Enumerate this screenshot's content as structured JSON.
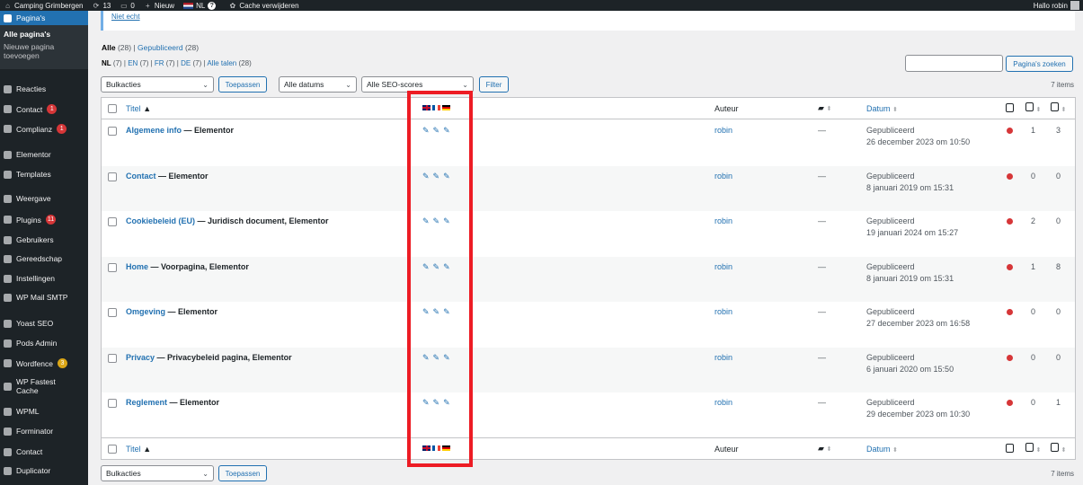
{
  "adminbar": {
    "site_name": "Camping Grimbergen",
    "updates": "13",
    "comments": "0",
    "new": "Nieuw",
    "lang": "NL",
    "cache": "Cache verwijderen",
    "greeting": "Hallo robin"
  },
  "sidebar": {
    "current": "Pagina's",
    "submenu": [
      "Alle pagina's",
      "Nieuwe pagina toevoegen"
    ],
    "items": [
      {
        "label": "Reacties",
        "icon": "comment-icon"
      },
      {
        "label": "Contact",
        "icon": "mail-icon",
        "badge": "1"
      },
      {
        "label": "Complianz",
        "icon": "check-icon",
        "badge": "1"
      },
      {
        "label": "Elementor",
        "icon": "elementor-icon"
      },
      {
        "label": "Templates",
        "icon": "folder-icon"
      },
      {
        "label": "Weergave",
        "icon": "brush-icon"
      },
      {
        "label": "Plugins",
        "icon": "plug-icon",
        "badge": "11"
      },
      {
        "label": "Gebruikers",
        "icon": "users-icon"
      },
      {
        "label": "Gereedschap",
        "icon": "wrench-icon"
      },
      {
        "label": "Instellingen",
        "icon": "settings-icon"
      },
      {
        "label": "WP Mail SMTP",
        "icon": "mail-smtp-icon"
      },
      {
        "label": "Yoast SEO",
        "icon": "yoast-icon"
      },
      {
        "label": "Pods Admin",
        "icon": "pods-icon"
      },
      {
        "label": "Wordfence",
        "icon": "wordfence-icon",
        "badge": "3"
      },
      {
        "label": "WP Fastest Cache",
        "icon": "cache-icon"
      },
      {
        "label": "WPML",
        "icon": "wpml-icon"
      },
      {
        "label": "Forminator",
        "icon": "forminator-icon"
      },
      {
        "label": "Contact",
        "icon": "contact-icon"
      },
      {
        "label": "Duplicator",
        "icon": "duplicator-icon"
      }
    ]
  },
  "notice": {
    "link": "Niet echt"
  },
  "filters": {
    "all": "Alle",
    "all_count": "(28)",
    "published": "Gepubliceerd",
    "published_count": "(28)",
    "langs": [
      {
        "code": "NL",
        "count": "(7)"
      },
      {
        "code": "EN",
        "count": "(7)"
      },
      {
        "code": "FR",
        "count": "(7)"
      },
      {
        "code": "DE",
        "count": "(7)"
      }
    ],
    "all_langs": "Alle talen",
    "all_langs_count": "(28)"
  },
  "search": {
    "button": "Pagina's zoeken"
  },
  "toolbar": {
    "bulk": "Bulkacties",
    "apply": "Toepassen",
    "dates": "Alle datums",
    "seo": "Alle SEO-scores",
    "filter": "Filter",
    "items": "7 items"
  },
  "table": {
    "col_title": "Titel",
    "col_author": "Auteur",
    "col_date": "Datum",
    "rows": [
      {
        "title": "Algemene info",
        "suffix": " — Elementor",
        "author": "robin",
        "comments": "—",
        "status": "Gepubliceerd",
        "date": "26 december 2023 om 10:50",
        "links_out": "1",
        "links_in": "3"
      },
      {
        "title": "Contact",
        "suffix": " — Elementor",
        "author": "robin",
        "comments": "—",
        "status": "Gepubliceerd",
        "date": "8 januari 2019 om 15:31",
        "links_out": "0",
        "links_in": "0"
      },
      {
        "title": "Cookiebeleid (EU)",
        "suffix": " — Juridisch document, Elementor",
        "author": "robin",
        "comments": "—",
        "status": "Gepubliceerd",
        "date": "19 januari 2024 om 15:27",
        "links_out": "2",
        "links_in": "0"
      },
      {
        "title": "Home",
        "suffix": " — Voorpagina, Elementor",
        "author": "robin",
        "comments": "—",
        "status": "Gepubliceerd",
        "date": "8 januari 2019 om 15:31",
        "links_out": "1",
        "links_in": "8"
      },
      {
        "title": "Omgeving",
        "suffix": " — Elementor",
        "author": "robin",
        "comments": "—",
        "status": "Gepubliceerd",
        "date": "27 december 2023 om 16:58",
        "links_out": "0",
        "links_in": "0"
      },
      {
        "title": "Privacy",
        "suffix": " — Privacybeleid pagina, Elementor",
        "author": "robin",
        "comments": "—",
        "status": "Gepubliceerd",
        "date": "6 januari 2020 om 15:50",
        "links_out": "0",
        "links_in": "0"
      },
      {
        "title": "Reglement",
        "suffix": " — Elementor",
        "author": "robin",
        "comments": "—",
        "status": "Gepubliceerd",
        "date": "29 december 2023 om 10:30",
        "links_out": "0",
        "links_in": "1"
      }
    ]
  },
  "colors": {
    "accent": "#2271b1",
    "highlight": "#ed1c24",
    "seo_dot": "#d63638"
  }
}
